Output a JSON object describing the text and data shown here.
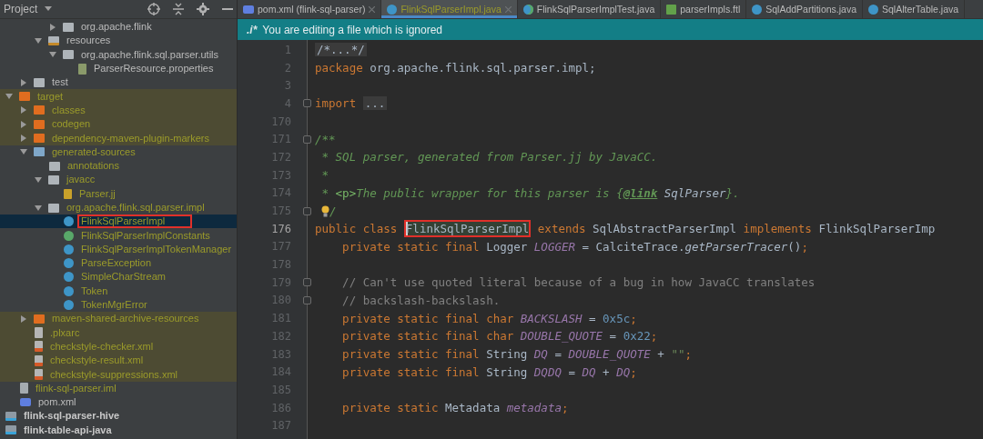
{
  "project_panel": {
    "title": "Project",
    "tree": [
      {
        "children": [
          {
            "children": [
              {
                "children": [
                  {
                    "children": [
                      {
                        "label": "org.apache.flink",
                        "kind": "package",
                        "expanded": false
                      }
                    ]
                  },
                  {
                    "label": "resources",
                    "kind": "resource-folder",
                    "expanded": true,
                    "children": [
                      {
                        "label": "org.apache.flink.sql.parser.utils",
                        "kind": "package",
                        "expanded": true,
                        "children": [
                          {
                            "label": "ParserResource.properties",
                            "kind": "properties"
                          }
                        ]
                      }
                    ]
                  }
                ]
              },
              {
                "label": "test",
                "kind": "folder",
                "expanded": false
              }
            ]
          },
          {
            "label": "target",
            "kind": "excluded-folder",
            "expanded": true,
            "ignored": true,
            "excluded": true,
            "children": [
              {
                "label": "classes",
                "kind": "excluded-folder",
                "expanded": false,
                "ignored": true,
                "excluded": true
              },
              {
                "label": "codegen",
                "kind": "excluded-folder",
                "expanded": false,
                "ignored": true,
                "excluded": true
              },
              {
                "label": "dependency-maven-plugin-markers",
                "kind": "excluded-folder",
                "expanded": false,
                "ignored": true,
                "excluded": true
              },
              {
                "label": "generated-sources",
                "kind": "generated-folder",
                "expanded": true,
                "ignored": true,
                "children": [
                  {
                    "label": "annotations",
                    "kind": "folder",
                    "ignored": true
                  },
                  {
                    "label": "javacc",
                    "kind": "folder",
                    "expanded": true,
                    "ignored": true,
                    "children": [
                      {
                        "label": "Parser.jj",
                        "kind": "grammar",
                        "ignored": true
                      }
                    ]
                  },
                  {
                    "label": "org.apache.flink.sql.parser.impl",
                    "kind": "package",
                    "expanded": true,
                    "ignored": true,
                    "children": [
                      {
                        "label": "FlinkSqlParserImpl",
                        "kind": "class",
                        "ignored": true,
                        "selected": true,
                        "boxed": true
                      },
                      {
                        "label": "FlinkSqlParserImplConstants",
                        "kind": "interface",
                        "ignored": true,
                        "selected": false
                      },
                      {
                        "label": "FlinkSqlParserImplTokenManager",
                        "kind": "class",
                        "ignored": true,
                        "selected": false
                      },
                      {
                        "label": "ParseException",
                        "kind": "class",
                        "ignored": true,
                        "selected": false
                      },
                      {
                        "label": "SimpleCharStream",
                        "kind": "class",
                        "ignored": true,
                        "selected": false
                      },
                      {
                        "label": "Token",
                        "kind": "class",
                        "ignored": true,
                        "selected": false
                      },
                      {
                        "label": "TokenMgrError",
                        "kind": "class",
                        "ignored": true,
                        "selected": false
                      }
                    ]
                  }
                ]
              },
              {
                "label": "maven-shared-archive-resources",
                "kind": "excluded-folder",
                "expanded": false,
                "ignored": true,
                "excluded": true
              },
              {
                "label": ".plxarc",
                "kind": "file",
                "ignored": true,
                "excluded": true
              },
              {
                "label": "checkstyle-checker.xml",
                "kind": "xml",
                "ignored": true,
                "excluded": true
              },
              {
                "label": "checkstyle-result.xml",
                "kind": "xml",
                "ignored": true,
                "excluded": true
              },
              {
                "label": "checkstyle-suppressions.xml",
                "kind": "xml",
                "ignored": true,
                "excluded": true
              }
            ]
          },
          {
            "label": "flink-sql-parser.iml",
            "kind": "iml",
            "ignored": true
          },
          {
            "label": "pom.xml",
            "kind": "maven"
          }
        ]
      },
      {
        "label": "flink-sql-parser-hive",
        "kind": "module",
        "bold": true
      },
      {
        "label": "flink-table-api-java",
        "kind": "module",
        "bold": true
      }
    ]
  },
  "tabs": [
    {
      "label": "pom.xml (flink-sql-parser)",
      "kind": "maven",
      "selected": false,
      "closable": true
    },
    {
      "label": "FlinkSqlParserImpl.java",
      "kind": "class",
      "selected": true,
      "ignored": true,
      "closable": true
    },
    {
      "label": "FlinkSqlParserImplTest.java",
      "kind": "test-class",
      "selected": false
    },
    {
      "label": "parserImpls.ftl",
      "kind": "template",
      "selected": false
    },
    {
      "label": "SqlAddPartitions.java",
      "kind": "class",
      "selected": false
    },
    {
      "label": "SqlAlterTable.java",
      "kind": "class",
      "selected": false
    }
  ],
  "notice": {
    "badge": ".i*",
    "text": "You are editing a file which is ignored"
  },
  "code_lines": [
    {
      "number": "1",
      "tokens": [
        {
          "kind": "folded",
          "text": "/*...*/"
        }
      ]
    },
    {
      "number": "2",
      "tokens": [
        {
          "kind": "keyword",
          "text": "package "
        },
        {
          "kind": "plain",
          "text": "org.apache.flink.sql.parser.impl;"
        }
      ]
    },
    {
      "number": "3"
    },
    {
      "number": "4",
      "fold_marker": true,
      "tokens": [
        {
          "kind": "keyword",
          "text": "import "
        },
        {
          "kind": "folded",
          "text": "..."
        }
      ]
    },
    {
      "number": "170"
    },
    {
      "number": "171",
      "fold_marker": true,
      "tokens": [
        {
          "kind": "doc",
          "text": "/**"
        }
      ]
    },
    {
      "number": "172",
      "tokens": [
        {
          "kind": "doc",
          "text": " * SQL parser, generated from Parser.jj by JavaCC."
        }
      ]
    },
    {
      "number": "173",
      "tokens": [
        {
          "kind": "doc",
          "text": " *"
        }
      ]
    },
    {
      "number": "174",
      "tokens": [
        {
          "kind": "doc",
          "text": " * "
        },
        {
          "kind": "doctag",
          "text": "<p>"
        },
        {
          "kind": "doc",
          "text": "The public wrapper for this parser is {"
        },
        {
          "kind": "doclink",
          "text": "@link"
        },
        {
          "kind": "docref",
          "text": " SqlParser"
        },
        {
          "kind": "doc",
          "text": "}."
        }
      ]
    },
    {
      "number": "175",
      "fold_marker": true,
      "tokens": [
        {
          "kind": "bulb"
        },
        {
          "kind": "doc",
          "text": "/"
        }
      ]
    },
    {
      "number": "176",
      "current": true,
      "tokens": [
        {
          "kind": "keyword",
          "text": "public class "
        },
        {
          "kind": "plain",
          "text": "FlinkSqlParserImpl",
          "boxed": true,
          "caret": true
        },
        {
          "kind": "keyword",
          "text": " extends "
        },
        {
          "kind": "plain",
          "text": "SqlAbstractParserImpl"
        },
        {
          "kind": "keyword",
          "text": " implements "
        },
        {
          "kind": "plain",
          "text": "FlinkSqlParserImp"
        }
      ]
    },
    {
      "number": "177",
      "tokens": [
        {
          "kind": "keyword",
          "text": "    private static final "
        },
        {
          "kind": "plain",
          "text": "Logger "
        },
        {
          "kind": "field",
          "text": "LOGGER"
        },
        {
          "kind": "plain",
          "text": " = CalciteTrace."
        },
        {
          "kind": "method",
          "text": "getParserTracer"
        },
        {
          "kind": "plain",
          "text": "()"
        },
        {
          "kind": "keyword",
          "text": ";"
        }
      ]
    },
    {
      "number": "178"
    },
    {
      "number": "179",
      "fold_marker": true,
      "tokens": [
        {
          "kind": "comment",
          "text": "    // Can't use quoted literal because of a bug in how JavaCC translates"
        }
      ]
    },
    {
      "number": "180",
      "fold_marker": true,
      "tokens": [
        {
          "kind": "comment",
          "text": "    // backslash-backslash."
        }
      ]
    },
    {
      "number": "181",
      "tokens": [
        {
          "kind": "keyword",
          "text": "    private static final char "
        },
        {
          "kind": "field",
          "text": "BACKSLASH"
        },
        {
          "kind": "plain",
          "text": " = "
        },
        {
          "kind": "number",
          "text": "0x5c"
        },
        {
          "kind": "keyword",
          "text": ";"
        }
      ]
    },
    {
      "number": "182",
      "tokens": [
        {
          "kind": "keyword",
          "text": "    private static final char "
        },
        {
          "kind": "field",
          "text": "DOUBLE_QUOTE"
        },
        {
          "kind": "plain",
          "text": " = "
        },
        {
          "kind": "number",
          "text": "0x22"
        },
        {
          "kind": "keyword",
          "text": ";"
        }
      ]
    },
    {
      "number": "183",
      "tokens": [
        {
          "kind": "keyword",
          "text": "    private static final "
        },
        {
          "kind": "plain",
          "text": "String "
        },
        {
          "kind": "field",
          "text": "DQ"
        },
        {
          "kind": "plain",
          "text": " = "
        },
        {
          "kind": "field",
          "text": "DOUBLE_QUOTE"
        },
        {
          "kind": "plain",
          "text": " + "
        },
        {
          "kind": "string",
          "text": "\"\""
        },
        {
          "kind": "keyword",
          "text": ";"
        }
      ]
    },
    {
      "number": "184",
      "tokens": [
        {
          "kind": "keyword",
          "text": "    private static final "
        },
        {
          "kind": "plain",
          "text": "String "
        },
        {
          "kind": "field",
          "text": "DQDQ"
        },
        {
          "kind": "plain",
          "text": " = "
        },
        {
          "kind": "field",
          "text": "DQ"
        },
        {
          "kind": "plain",
          "text": " + "
        },
        {
          "kind": "field",
          "text": "DQ"
        },
        {
          "kind": "keyword",
          "text": ";"
        }
      ]
    },
    {
      "number": "185"
    },
    {
      "number": "186",
      "tokens": [
        {
          "kind": "keyword",
          "text": "    private static "
        },
        {
          "kind": "plain",
          "text": "Metadata "
        },
        {
          "kind": "field",
          "text": "metadata"
        },
        {
          "kind": "keyword",
          "text": ";"
        }
      ]
    },
    {
      "number": "187"
    }
  ]
}
